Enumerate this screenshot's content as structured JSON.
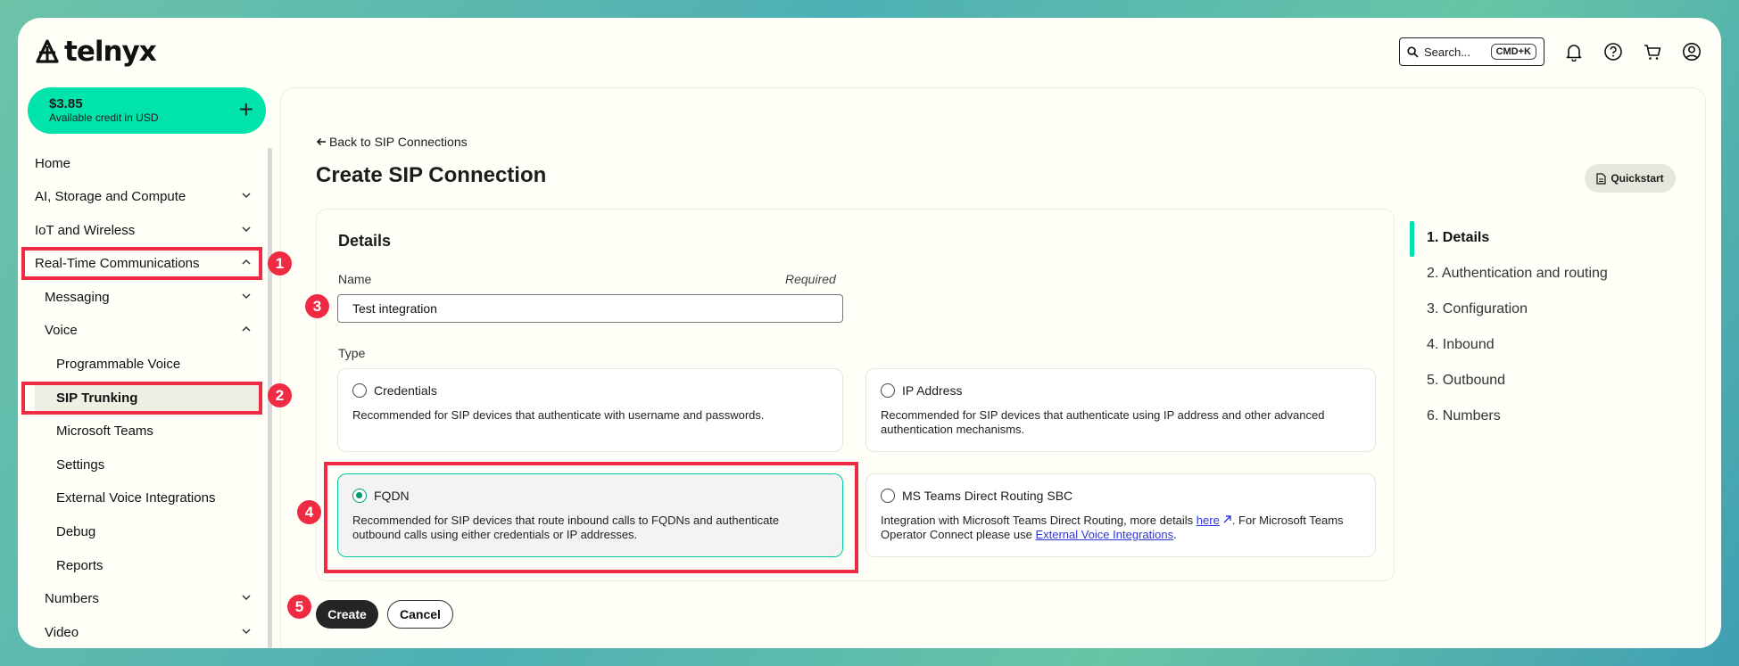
{
  "header": {
    "brand": "telnyx",
    "search_label": "Search...",
    "search_shortcut": "CMD+K",
    "icons": [
      "bell-icon",
      "help-icon",
      "cart-icon",
      "user-icon"
    ]
  },
  "sidebar": {
    "credit": {
      "amount": "$3.85",
      "label": "Available credit in USD",
      "add": "+"
    },
    "items": [
      {
        "label": "Home"
      },
      {
        "label": "AI, Storage and Compute"
      },
      {
        "label": "IoT and Wireless"
      },
      {
        "label": "Real-Time Communications"
      },
      {
        "label": "Messaging"
      },
      {
        "label": "Voice"
      },
      {
        "label": "Programmable Voice"
      },
      {
        "label": "SIP Trunking"
      },
      {
        "label": "Microsoft Teams"
      },
      {
        "label": "Settings"
      },
      {
        "label": "External Voice Integrations"
      },
      {
        "label": "Debug"
      },
      {
        "label": "Reports"
      },
      {
        "label": "Numbers"
      },
      {
        "label": "Video"
      }
    ]
  },
  "main": {
    "back_link": "Back to SIP Connections",
    "title": "Create SIP Connection",
    "quickstart": "Quickstart",
    "details_heading": "Details",
    "name_label": "Name",
    "name_required": "Required",
    "name_value": "Test integration",
    "type_label": "Type",
    "types": [
      {
        "label": "Credentials",
        "desc": "Recommended for SIP devices that authenticate with username and passwords."
      },
      {
        "label": "IP Address",
        "desc": "Recommended for SIP devices that authenticate using IP address and other advanced authentication mechanisms."
      },
      {
        "label": "FQDN",
        "desc": "Recommended for SIP devices that route inbound calls to FQDNs and authenticate outbound calls using either credentials or IP addresses."
      },
      {
        "label": "MS Teams Direct Routing SBC",
        "desc_pre": "Integration with Microsoft Teams Direct Routing, more details ",
        "desc_link": "here",
        "desc_mid": ". For Microsoft Teams Operator Connect please use ",
        "desc_link2": "External Voice Integrations",
        "desc_post": "."
      }
    ],
    "selected_type": "FQDN",
    "create_button": "Create",
    "cancel_button": "Cancel"
  },
  "steps": [
    {
      "label": "1. Details"
    },
    {
      "label": "2. Authentication and routing"
    },
    {
      "label": "3. Configuration"
    },
    {
      "label": "4. Inbound"
    },
    {
      "label": "5. Outbound"
    },
    {
      "label": "6. Numbers"
    }
  ],
  "annotations": [
    "1",
    "2",
    "3",
    "4",
    "5"
  ],
  "colors": {
    "accent": "#00e3aa",
    "annotation_red": "#ee2b43",
    "link": "#2d38d8"
  }
}
